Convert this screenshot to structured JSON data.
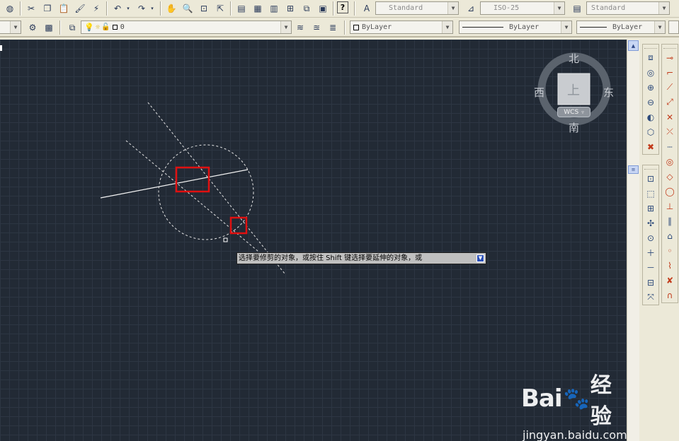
{
  "toolbar_standard": {
    "icons": [
      "globe-icon",
      "scissors-icon",
      "copy-icon",
      "paste-icon",
      "match-properties-icon",
      "block-editor-icon",
      "undo-icon",
      "redo-icon",
      "pan-icon",
      "zoom-realtime-icon",
      "zoom-window-icon",
      "zoom-previous-icon",
      "properties-icon",
      "design-center-icon",
      "tool-palettes-icon",
      "sheet-set-icon",
      "markup-icon",
      "calculator-icon",
      "help-icon"
    ]
  },
  "styles": {
    "text_style": "Standard",
    "dim_style": "ISO-25",
    "table_style": "Standard"
  },
  "layers": {
    "current_layer": "0",
    "color": "ByLayer",
    "linetype": "ByLayer",
    "lineweight": "ByLayer"
  },
  "viewcube": {
    "north": "北",
    "south": "南",
    "east": "东",
    "west": "西",
    "face": "上",
    "wcs_label": "WCS"
  },
  "command_prompt": {
    "text": "选择要修剪的对象，或按住 Shift 键选择要延伸的对象，或"
  },
  "watermark": {
    "brand": "Bai",
    "brand2": "经验",
    "url": "jingyan.baidu.com"
  },
  "colors": {
    "canvas_bg": "#222a35",
    "grid": "#2d3643",
    "highlight_box": "#e01010",
    "geometry": "#e6e6e6"
  }
}
